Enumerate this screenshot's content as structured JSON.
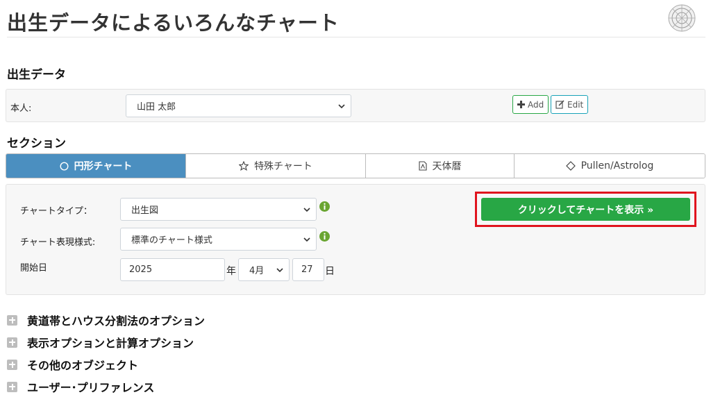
{
  "page": {
    "title": "出生データによるいろんなチャート"
  },
  "birth_data": {
    "heading": "出生データ",
    "subject_label": "本人:",
    "subject_value": "山田 太郎",
    "add_label": "Add",
    "edit_label": "Edit"
  },
  "section": {
    "heading": "セクション",
    "tabs": [
      {
        "label": "円形チャート",
        "icon": "circle-icon",
        "active": true
      },
      {
        "label": "特殊チャート",
        "icon": "star-icon",
        "active": false
      },
      {
        "label": "天体暦",
        "icon": "document-icon",
        "active": false
      },
      {
        "label": "Pullen/Astrolog",
        "icon": "diamond-icon",
        "active": false
      }
    ]
  },
  "chart_form": {
    "type_label": "チャートタイプ：",
    "type_value": "出生図",
    "style_label": "チャート表現様式:",
    "style_value": "標準のチャート様式",
    "start_label": "開始日",
    "year_value": "2025",
    "year_unit": "年",
    "month_value": "4月",
    "day_value": "27",
    "day_unit": "日",
    "submit_label": "クリックしてチャートを表示 »"
  },
  "accordion": [
    {
      "label": "黄道帯とハウス分割法のオプション"
    },
    {
      "label": "表示オプションと計算オプション"
    },
    {
      "label": "その他のオブジェクト"
    },
    {
      "label": "ユーザー･プリファレンス"
    }
  ],
  "colors": {
    "tab_active": "#4b8fc0",
    "submit_button": "#28a745",
    "highlight_frame": "#e0141e",
    "info_icon": "#6aa532"
  }
}
